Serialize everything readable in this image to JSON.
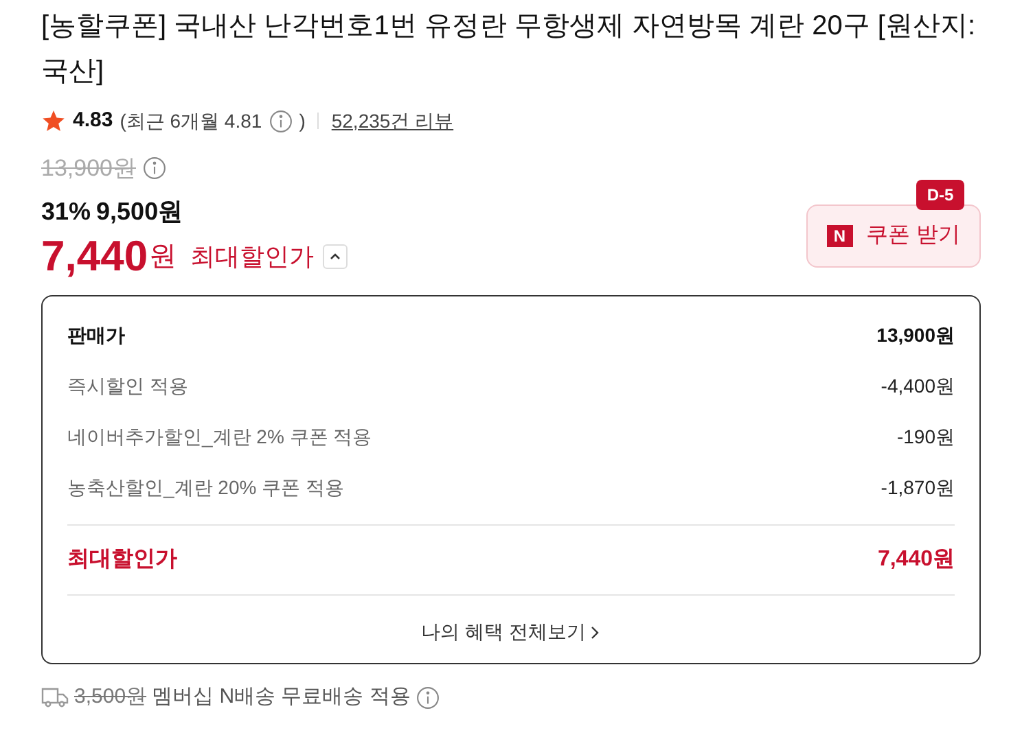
{
  "title": "[농할쿠폰] 국내산 난각번호1번 유정란 무항생제 자연방목 계란 20구 [원산지:국산]",
  "rating": {
    "score": "4.83",
    "recent_open": "(최근 6개월 4.81",
    "recent_close": ")",
    "reviews": "52,235건 리뷰"
  },
  "original_price": "13,900원",
  "discount": {
    "rate": "31%",
    "price": "9,500원"
  },
  "max_price": {
    "amount": "7,440",
    "unit": "원",
    "label": "최대할인가",
    "expanded": true
  },
  "coupon_button": {
    "logo": "N",
    "label": "쿠폰 받기",
    "badge": "D-5"
  },
  "breakdown": {
    "rows": [
      {
        "kind": "base",
        "label": "판매가",
        "value": "13,900원"
      },
      {
        "kind": "discount",
        "label": "즉시할인 적용",
        "value": "-4,400원"
      },
      {
        "kind": "discount",
        "label": "네이버추가할인_계란 2% 쿠폰 적용",
        "value": "-190원"
      },
      {
        "kind": "discount",
        "label": "농축산할인_계란 20% 쿠폰 적용",
        "value": "-1,870원"
      },
      {
        "kind": "total",
        "label": "최대할인가",
        "value": "7,440원"
      }
    ],
    "link": "나의 혜택 전체보기"
  },
  "shipping": {
    "fee": "3,500원",
    "text": "멤버십 N배송 무료배송 적용"
  }
}
